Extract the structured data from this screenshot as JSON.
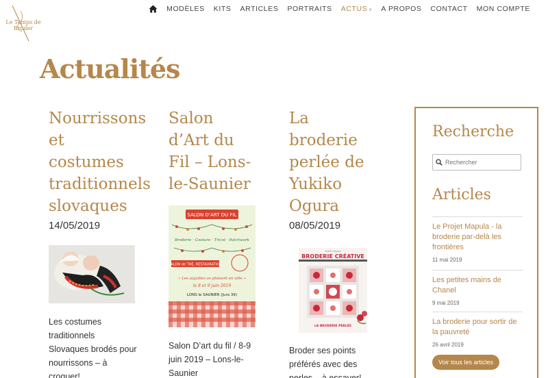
{
  "brand": {
    "logo_text_1": "Le Temps de",
    "logo_text_2": "Broder",
    "accent_color": "#b5874a"
  },
  "nav": {
    "home_icon": "home-icon",
    "items": [
      {
        "label": "MODÈLES"
      },
      {
        "label": "KITS"
      },
      {
        "label": "ARTICLES"
      },
      {
        "label": "PORTRAITS"
      },
      {
        "label": "ACTUS",
        "active": true
      },
      {
        "label": "A PROPOS"
      },
      {
        "label": "CONTACT"
      },
      {
        "label": "MON COMPTE"
      }
    ],
    "actus_chevron": "»"
  },
  "page_title": "Actualités",
  "posts": [
    {
      "title_lines": [
        "Nourrissons",
        "et",
        "costumes",
        "traditionnels",
        "slovaques"
      ],
      "date": "14/05/2019",
      "excerpt_lines": [
        "Les costumes",
        "traditionnels",
        "Slovaques brodés pour",
        "nourrissons – à",
        "croquer!"
      ]
    },
    {
      "title_lines": [
        "Salon",
        "d’Art du",
        "Fil – Lons-",
        "le-Saunier"
      ],
      "poster": {
        "line1": "SALON D’ART DU FIL",
        "line2": "Broderie · Couture · Tricot · Patchwork",
        "line3": "SALON de THÉ, RESTAURATION",
        "line4": "« Les aiguilles se plaisent en ville »",
        "line5": "le 8 et 9 juin 2019",
        "line6": "LONS le SAUNIER (Jura 39)"
      },
      "excerpt_lines": [
        "Salon D’art du fil / 8-9",
        "juin 2019 – Lons-le-",
        "Saunier"
      ]
    },
    {
      "title_lines": [
        "La",
        "broderie",
        "perlée de",
        "Yukiko",
        "Ogura"
      ],
      "date": "08/05/2019",
      "book": {
        "title": "BRODERIE CRÉATIVE",
        "subtitle": "LA BRODERIE PERLÉE",
        "author": "Yukiko Ogura"
      },
      "excerpt_lines": [
        "Broder ses points",
        "préférés avec des",
        "perles... à essayer!"
      ]
    }
  ],
  "sidebar": {
    "search_heading": "Recherche",
    "search_placeholder": "Rechercher",
    "articles_heading": "Articles",
    "articles": [
      {
        "title": "Le Projet Mapula - la broderie par-delà les frontières",
        "date": "11 mai 2019"
      },
      {
        "title": "Les petites mains de Chanel",
        "date": "9 mai 2019"
      },
      {
        "title": "La broderie pour sortir de la pauvreté",
        "date": "26 avril 2019"
      }
    ],
    "all_button": "Voir tous les articles"
  }
}
